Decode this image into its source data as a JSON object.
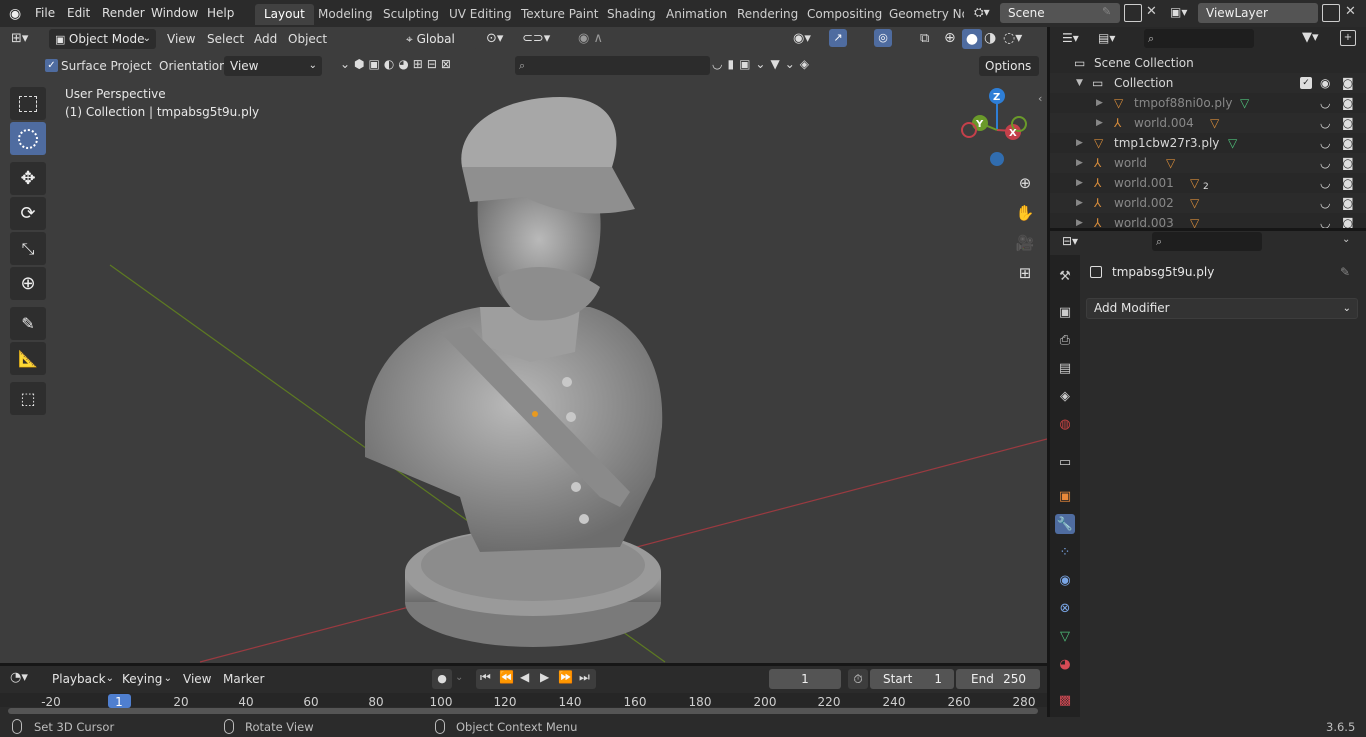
{
  "menubar": {
    "items": [
      "File",
      "Edit",
      "Render",
      "Window",
      "Help"
    ],
    "workspaces": [
      "Layout",
      "Modeling",
      "Sculpting",
      "UV Editing",
      "Texture Paint",
      "Shading",
      "Animation",
      "Rendering",
      "Compositing",
      "Geometry Noc"
    ],
    "scene": "Scene",
    "view_layer": "ViewLayer"
  },
  "viewport_header": {
    "mode": "Object Mode",
    "menus": [
      "View",
      "Select",
      "Add",
      "Object"
    ],
    "transform_orientation": "Global",
    "surface_project": "Surface Project",
    "orientation_label": "Orientation:",
    "orientation_value": "View",
    "options": "Options"
  },
  "viewport": {
    "perspective": "User Perspective",
    "collection_info": "(1) Collection | tmpabsg5t9u.ply",
    "gizmo_axes": {
      "z": "Z",
      "y": "Y",
      "x": "X"
    }
  },
  "outliner": {
    "scene_collection": "Scene Collection",
    "collection": "Collection",
    "items": [
      {
        "name": "tmpof88ni0o.ply",
        "indent": 2
      },
      {
        "name": "world.004",
        "indent": 2
      },
      {
        "name": "tmp1cbw27r3.ply",
        "indent": 1
      },
      {
        "name": "world",
        "indent": 1
      },
      {
        "name": "world.001",
        "indent": 1,
        "badge": "2"
      },
      {
        "name": "world.002",
        "indent": 1
      },
      {
        "name": "world.003",
        "indent": 1
      }
    ]
  },
  "properties": {
    "object_name": "tmpabsg5t9u.ply",
    "add_modifier": "Add Modifier"
  },
  "timeline": {
    "menus": [
      "Playback",
      "Keying",
      "View",
      "Marker"
    ],
    "current_frame": "1",
    "start_label": "Start",
    "start_value": "1",
    "end_label": "End",
    "end_value": "250",
    "ticks": [
      "-20",
      "1",
      "20",
      "40",
      "60",
      "80",
      "100",
      "120",
      "140",
      "160",
      "180",
      "200",
      "220",
      "240",
      "260",
      "280"
    ]
  },
  "statusbar": {
    "left": "Set 3D Cursor",
    "middle": "Rotate View",
    "right": "Object Context Menu",
    "version": "3.6.5"
  },
  "colors": {
    "accent": "#4f6ca0",
    "x_axis": "#c4404a",
    "y_axis": "#6a9a2a",
    "z_axis": "#2e7ed6"
  }
}
